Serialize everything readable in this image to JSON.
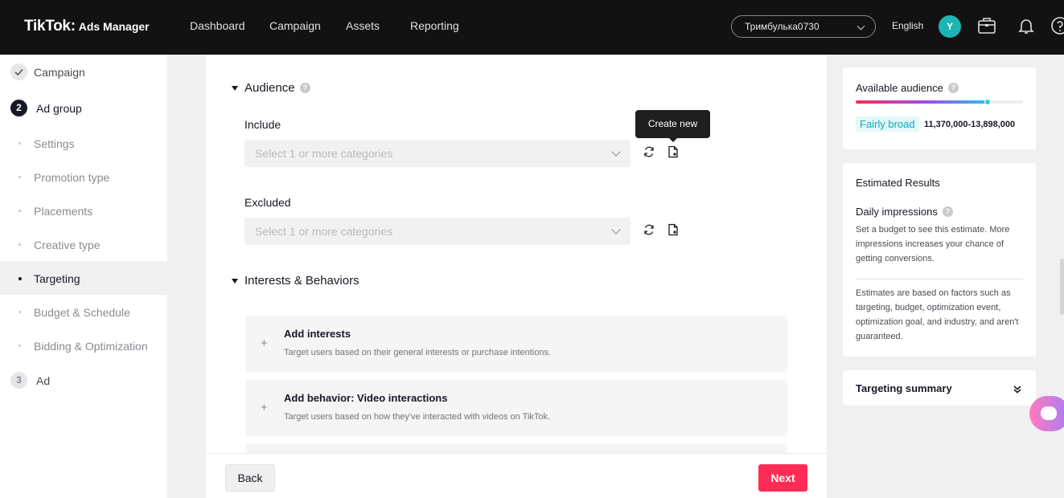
{
  "header": {
    "logo_main": "TikTok",
    "logo_dot": ":",
    "logo_sub": "Ads Manager",
    "nav": [
      "Dashboard",
      "Campaign",
      "Assets",
      "Reporting"
    ],
    "account_name": "Тримбулька0730",
    "language": "English",
    "avatar_letter": "Y"
  },
  "sidebar": {
    "step1": {
      "label": "Campaign"
    },
    "step2": {
      "number": "2",
      "label": "Ad group"
    },
    "substeps": [
      "Settings",
      "Promotion type",
      "Placements",
      "Creative type",
      "Targeting",
      "Budget & Schedule",
      "Bidding & Optimization"
    ],
    "active_substep": "Targeting",
    "step3": {
      "number": "3",
      "label": "Ad"
    }
  },
  "audience": {
    "title": "Audience",
    "include_label": "Include",
    "include_placeholder": "Select 1 or more categories",
    "excluded_label": "Excluded",
    "excluded_placeholder": "Select 1 or more categories",
    "tooltip": "Create new"
  },
  "interests": {
    "title": "Interests & Behaviors",
    "cards": [
      {
        "title": "Add interests",
        "desc": "Target users based on their general interests or purchase intentions."
      },
      {
        "title": "Add behavior: Video interactions",
        "desc": "Target users based on how they've interacted with videos on TikTok."
      }
    ]
  },
  "footer": {
    "back": "Back",
    "next": "Next"
  },
  "right_panel": {
    "available_title": "Available audience",
    "audience_level": 0.79,
    "broad_label": "Fairly broad",
    "range": "11,370,000-13,898,000",
    "estimated_title": "Estimated Results",
    "daily_title": "Daily impressions",
    "daily_text": "Set a budget to see this estimate. More impressions increases your chance of getting conversions.",
    "note_text": "Estimates are based on factors such as targeting, budget, optimization event, optimization goal, and industry, and aren't guaranteed.",
    "summary_title": "Targeting summary"
  },
  "colors": {
    "accent": "#fe2c55",
    "teal": "#1cb5b5",
    "topbar": "#121212"
  },
  "icons": {
    "refresh": "refresh-icon",
    "create": "create-file-icon",
    "briefcase": "briefcase-icon",
    "bell": "bell-icon",
    "help": "help-icon",
    "chat": "chat-icon"
  }
}
